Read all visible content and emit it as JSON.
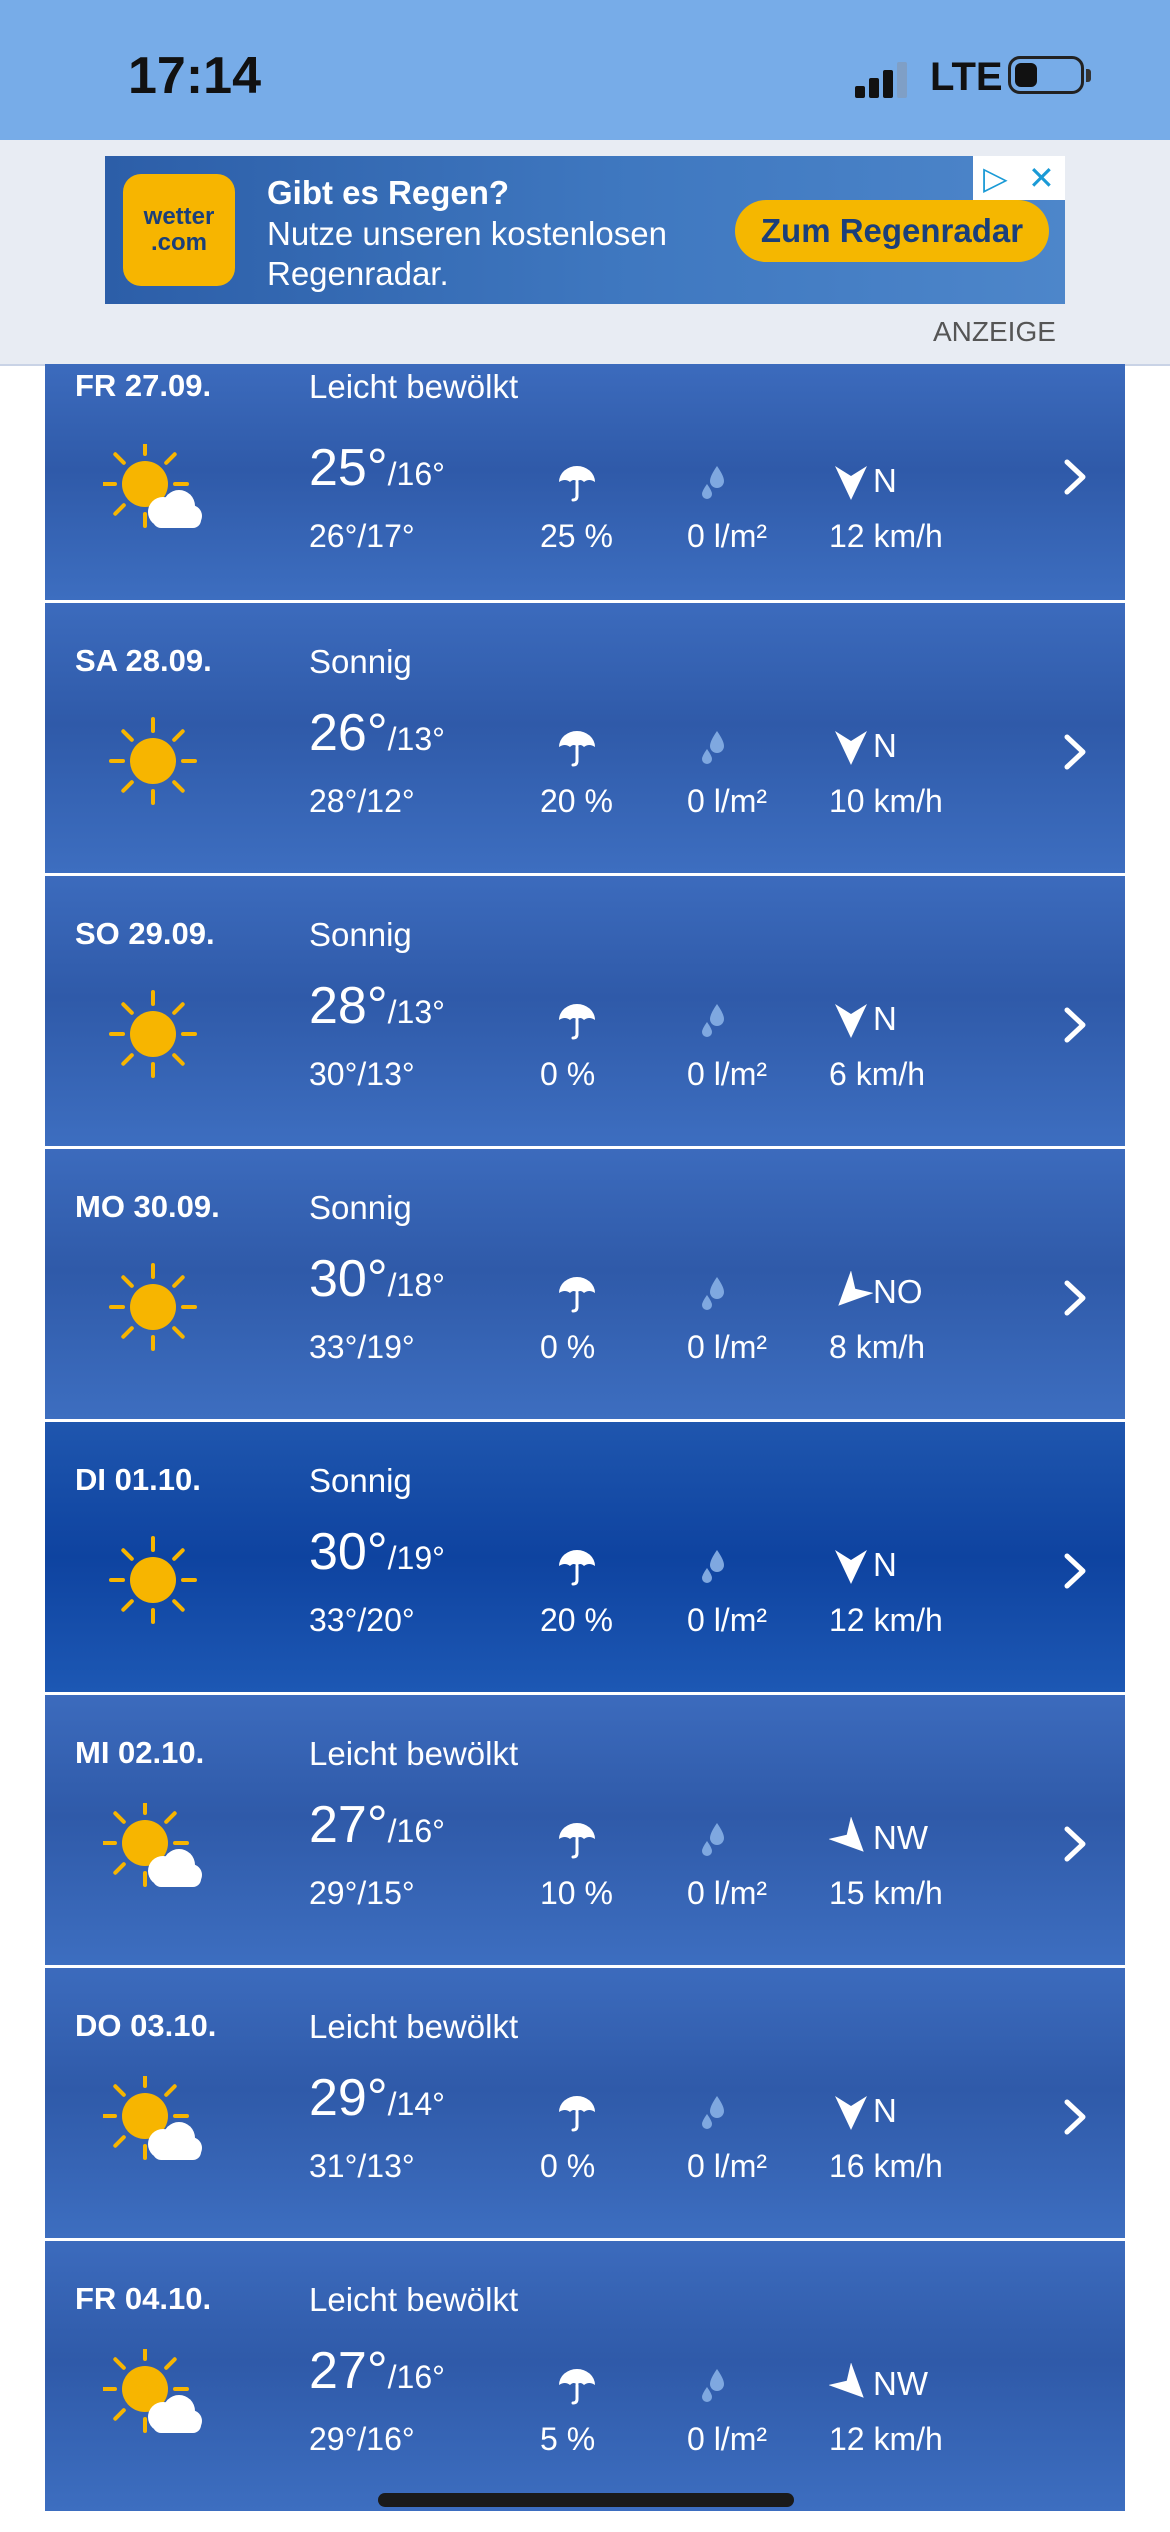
{
  "status_bar": {
    "time": "17:14",
    "network": "LTE"
  },
  "ad": {
    "logo_line1": "wetter",
    "logo_line2": ".com",
    "headline": "Gibt es Regen?",
    "text": "Nutze unseren kostenlosen Regenradar.",
    "cta": "Zum Regenradar",
    "label": "ANZEIGE"
  },
  "days": [
    {
      "date": "FR 27.09.",
      "condition": "Leicht bewölkt",
      "icon": "partly-cloudy-icon",
      "max": "25°",
      "min": "/16°",
      "feels": "26°/17°",
      "precip_prob": "25 %",
      "precip_amt": "0 l/m²",
      "wind_dir": "N",
      "wind_speed": "12 km/h",
      "wind_rot": 0
    },
    {
      "date": "SA 28.09.",
      "condition": "Sonnig",
      "icon": "sun-icon",
      "max": "26°",
      "min": "/13°",
      "feels": "28°/12°",
      "precip_prob": "20 %",
      "precip_amt": "0 l/m²",
      "wind_dir": "N",
      "wind_speed": "10 km/h",
      "wind_rot": 0
    },
    {
      "date": "SO 29.09.",
      "condition": "Sonnig",
      "icon": "sun-icon",
      "max": "28°",
      "min": "/13°",
      "feels": "30°/13°",
      "precip_prob": "0 %",
      "precip_amt": "0 l/m²",
      "wind_dir": "N",
      "wind_speed": "6 km/h",
      "wind_rot": 0
    },
    {
      "date": "MO 30.09.",
      "condition": "Sonnig",
      "icon": "sun-icon",
      "max": "30°",
      "min": "/18°",
      "feels": "33°/19°",
      "precip_prob": "0 %",
      "precip_amt": "0 l/m²",
      "wind_dir": "NO",
      "wind_speed": "8 km/h",
      "wind_rot": 45
    },
    {
      "date": "DI 01.10.",
      "condition": "Sonnig",
      "icon": "sun-icon",
      "max": "30°",
      "min": "/19°",
      "feels": "33°/20°",
      "precip_prob": "20 %",
      "precip_amt": "0 l/m²",
      "wind_dir": "N",
      "wind_speed": "12 km/h",
      "wind_rot": 0
    },
    {
      "date": "MI 02.10.",
      "condition": "Leicht bewölkt",
      "icon": "partly-cloudy-icon",
      "max": "27°",
      "min": "/16°",
      "feels": "29°/15°",
      "precip_prob": "10 %",
      "precip_amt": "0 l/m²",
      "wind_dir": "NW",
      "wind_speed": "15 km/h",
      "wind_rot": -45
    },
    {
      "date": "DO 03.10.",
      "condition": "Leicht bewölkt",
      "icon": "partly-cloudy-icon",
      "max": "29°",
      "min": "/14°",
      "feels": "31°/13°",
      "precip_prob": "0 %",
      "precip_amt": "0 l/m²",
      "wind_dir": "N",
      "wind_speed": "16 km/h",
      "wind_rot": 0
    },
    {
      "date": "FR 04.10.",
      "condition": "Leicht bewölkt",
      "icon": "partly-cloudy-icon",
      "max": "27°",
      "min": "/16°",
      "feels": "29°/16°",
      "precip_prob": "5 %",
      "precip_amt": "0 l/m²",
      "wind_dir": "NW",
      "wind_speed": "12 km/h",
      "wind_rot": -45
    }
  ],
  "colors": {
    "status_bar": "#77ace8",
    "card": "#3462b0",
    "accent_sun": "#f7b500"
  }
}
